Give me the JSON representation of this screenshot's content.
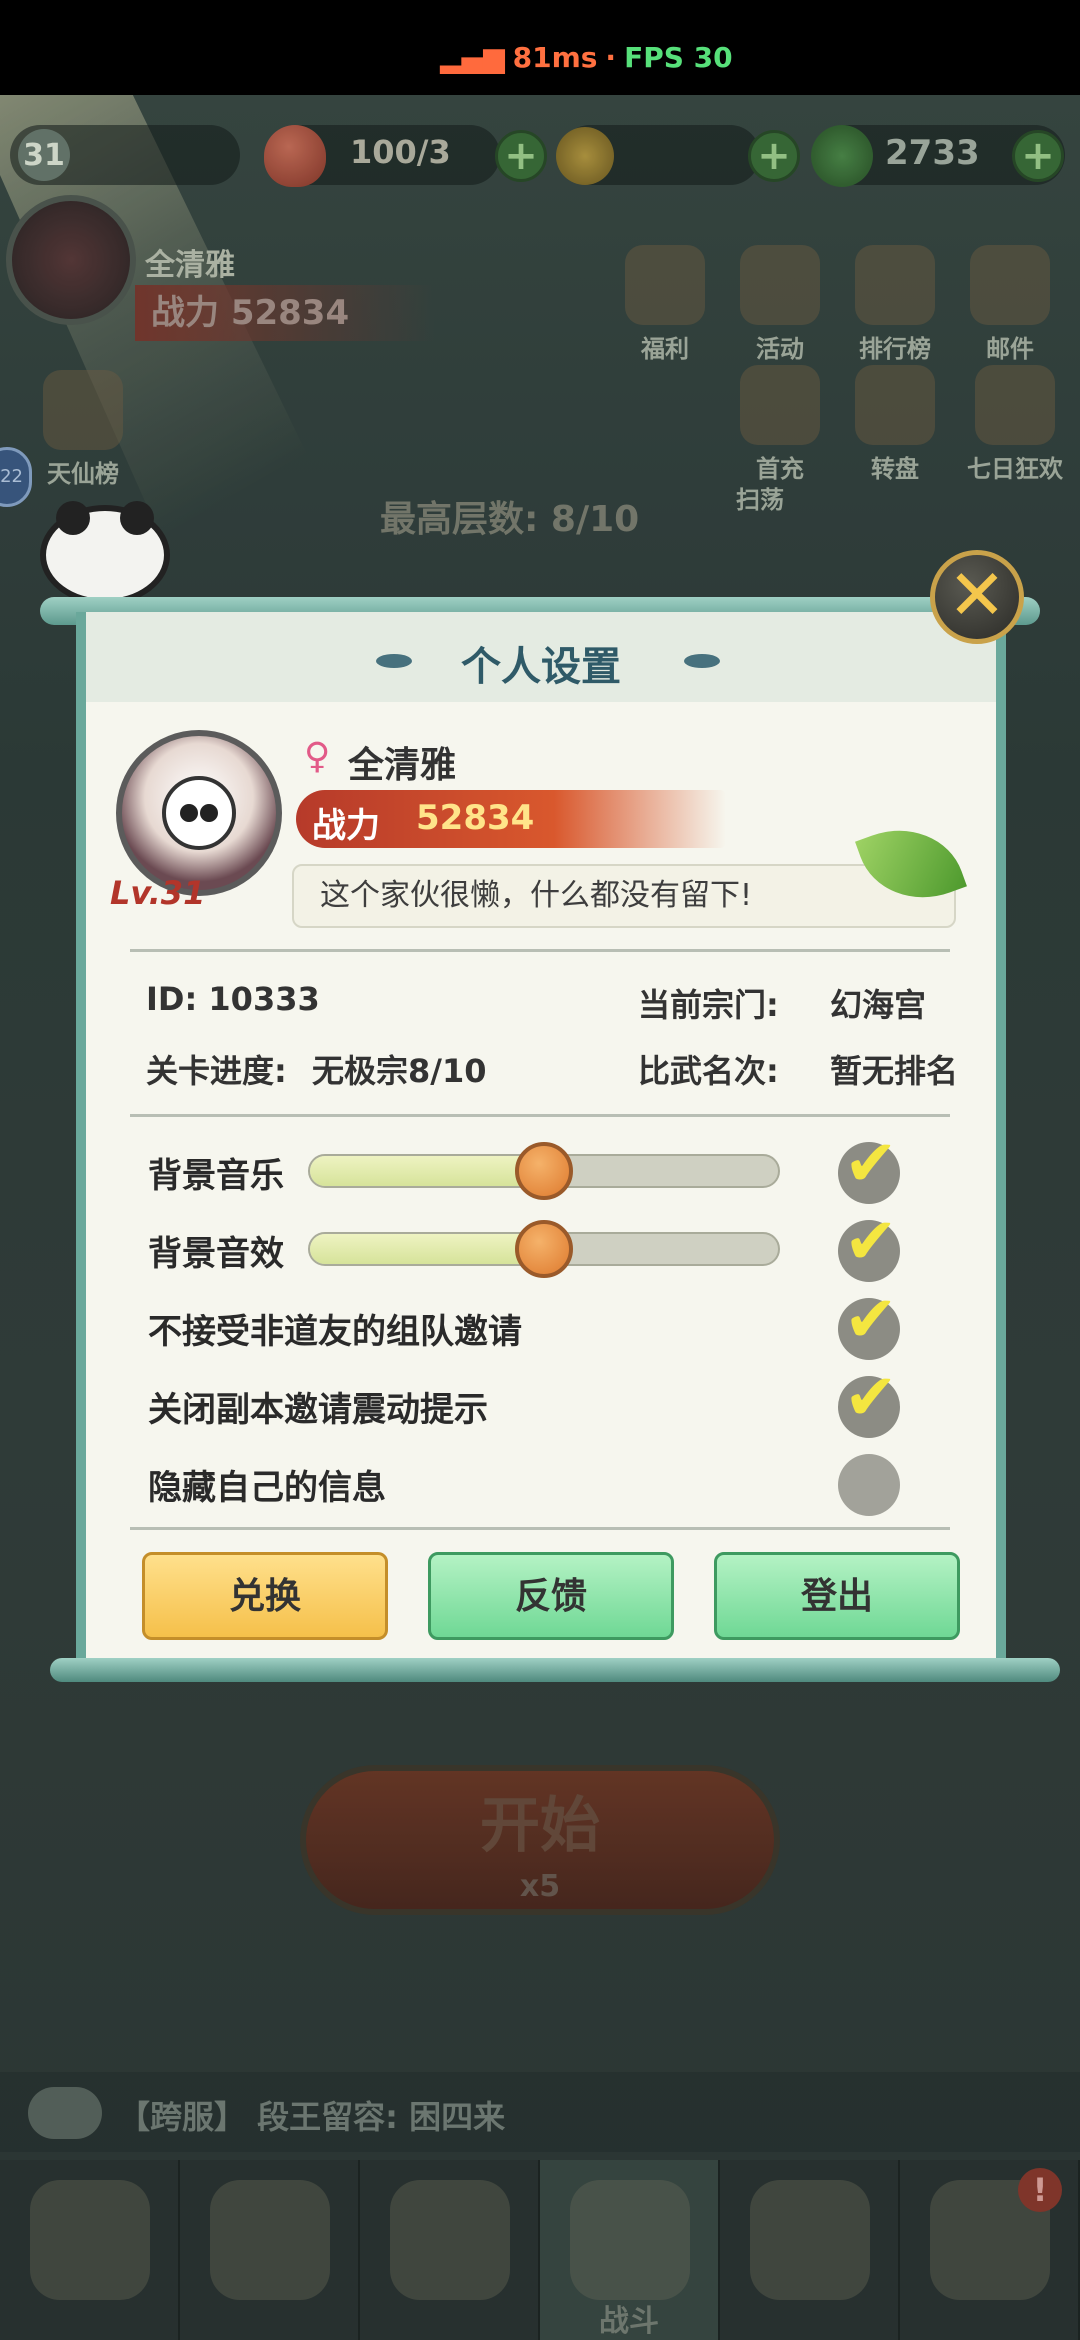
{
  "status": {
    "ping": "81ms",
    "separator": "·",
    "fps": "FPS 30"
  },
  "hud": {
    "level": "31",
    "stamina": "100/3",
    "jade": "2733",
    "player_name": "全清雅",
    "player_power": "战力 52834",
    "menu": [
      {
        "label": "福利"
      },
      {
        "label": "活动"
      },
      {
        "label": "排行榜"
      },
      {
        "label": "邮件"
      },
      {
        "label": "天仙榜"
      },
      {
        "label": "首充"
      },
      {
        "label": "转盘"
      },
      {
        "label": "七日狂欢"
      },
      {
        "label": "扫荡"
      }
    ],
    "stage_text": "最高层数: 8/10",
    "side_badge": "22",
    "start_label": "开始",
    "start_cost": "x5",
    "chat": "【跨服】 段王留容: 困四来",
    "nav_label": "战斗",
    "nav_badge": "!"
  },
  "dialog": {
    "title": "个人设置",
    "gender_symbol": "♀",
    "name": "全清雅",
    "level": "Lv.31",
    "power_label": "战力",
    "power_value": "52834",
    "motto": "这个家伙很懒，什么都没有留下!",
    "id_text": "ID: 10333",
    "sect_label": "当前宗门:",
    "sect_value": "幻海宫",
    "progress_label": "关卡进度:",
    "progress_value": "无极宗8/10",
    "rank_label": "比武名次:",
    "rank_value": "暂无排名",
    "settings": [
      {
        "label": "背景音乐",
        "type": "slider",
        "level": 0.5,
        "checked": true
      },
      {
        "label": "背景音效",
        "type": "slider",
        "level": 0.5,
        "checked": true
      },
      {
        "label": "不接受非道友的组队邀请",
        "type": "toggle",
        "checked": true
      },
      {
        "label": "关闭副本邀请震动提示",
        "type": "toggle",
        "checked": true
      },
      {
        "label": "隐藏自己的信息",
        "type": "toggle",
        "checked": false
      }
    ],
    "buttons": {
      "redeem": "兑换",
      "feedback": "反馈",
      "logout": "登出"
    },
    "close_symbol": "✕"
  },
  "colors": {
    "accent_green": "#6aa89b",
    "power_red": "#d9582d",
    "check_yellow": "#f4e640"
  }
}
